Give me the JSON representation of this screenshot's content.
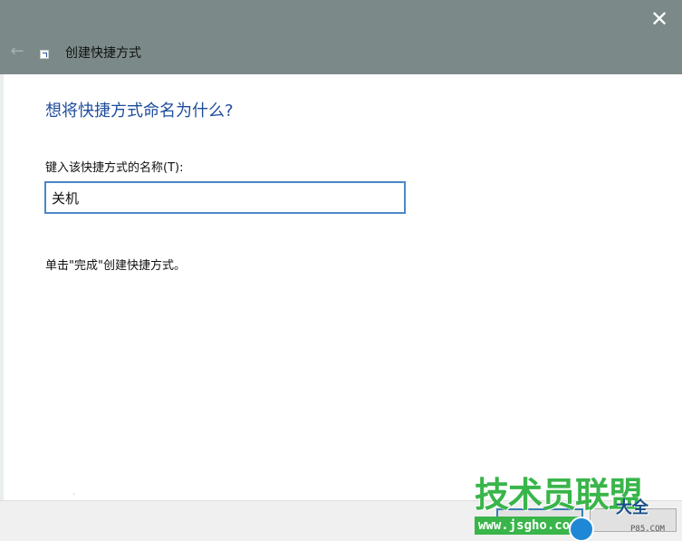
{
  "window": {
    "title": "创建快捷方式",
    "close_glyph": "✕",
    "back_glyph": "←"
  },
  "main": {
    "heading": "想将快捷方式命名为什么?",
    "name_label": "键入该快捷方式的名称(T):",
    "name_value": "关机",
    "hint": "单击\"完成\"创建快捷方式。"
  },
  "footer": {
    "finish_label": "",
    "cancel_label": ""
  },
  "watermark": {
    "main_text": "技术员联盟",
    "url_text": "www.jsgho.com",
    "side_text": "大全",
    "tiny_text": "P85.COM"
  },
  "colors": {
    "titlebar": "#7b8a88",
    "heading": "#1f4e9c",
    "input_border": "#4b88c7",
    "watermark_green": "#39b54a"
  },
  "icons": {
    "close": "close-icon",
    "back": "back-arrow-icon",
    "shortcut": "shortcut-icon"
  }
}
